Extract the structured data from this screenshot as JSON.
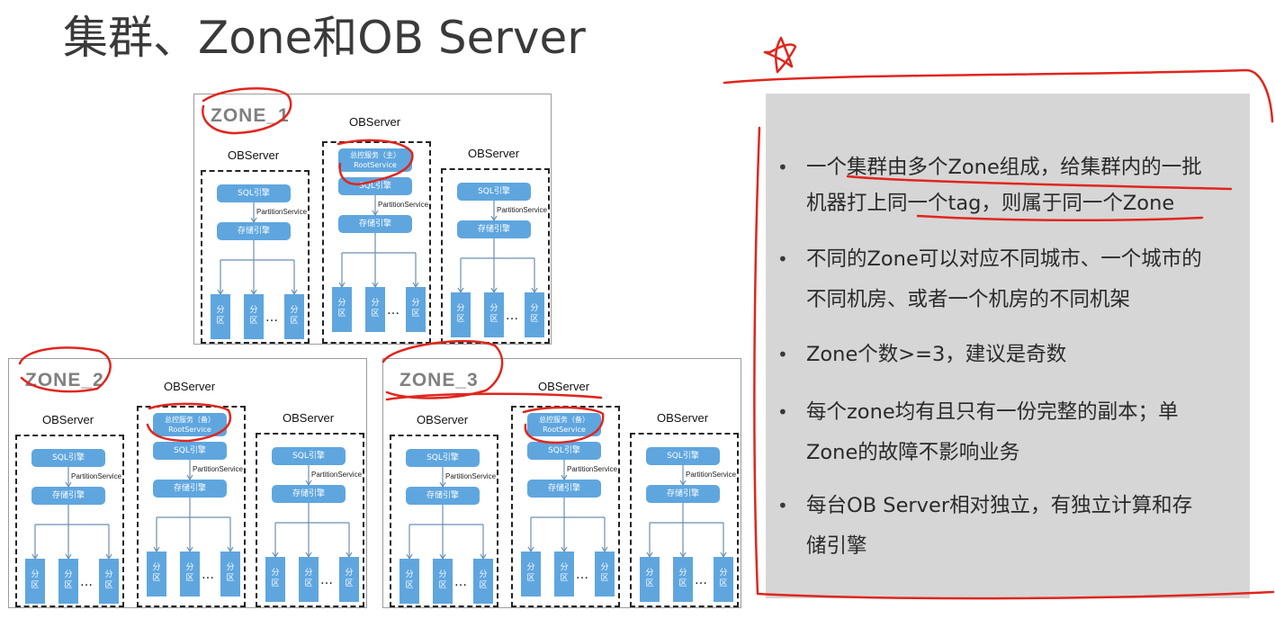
{
  "title": "集群、Zone和OB Server",
  "labels": {
    "observer": "OBServer",
    "sql_engine": "SQL引擎",
    "partition_service": "PartitionService",
    "storage_engine": "存储引擎",
    "partition_top": "分",
    "partition_bottom": "区",
    "ellipsis": "…",
    "root_service_sub": "RootService"
  },
  "zones": [
    {
      "name": "ZONE_1",
      "root_service": "总控服务（主）"
    },
    {
      "name": "ZONE_2",
      "root_service": "总控服务（备）"
    },
    {
      "name": "ZONE_3",
      "root_service": "总控服务（备）"
    }
  ],
  "bullets": [
    {
      "line1": "一个集群由多个Zone组成，给集群内的一批",
      "line2": "机器打上同一个tag，则属于同一个Zone"
    },
    {
      "line1": "不同的Zone可以对应不同城市、一个城市的",
      "line2": "不同机房、或者一个机房的不同机架"
    },
    {
      "line1": "Zone个数>=3，建议是奇数",
      "line2": ""
    },
    {
      "line1": "每个zone均有且只有一份完整的副本；单",
      "line2": "Zone的故障不影响业务"
    },
    {
      "line1": "每台OB  Server相对独立，有独立计算和存",
      "line2": "储引擎"
    }
  ],
  "colors": {
    "node_blue": "#5fa6df",
    "panel_gray": "#d6d6d6",
    "annotation_red": "#e0261d"
  },
  "bullet_symbol": "•"
}
